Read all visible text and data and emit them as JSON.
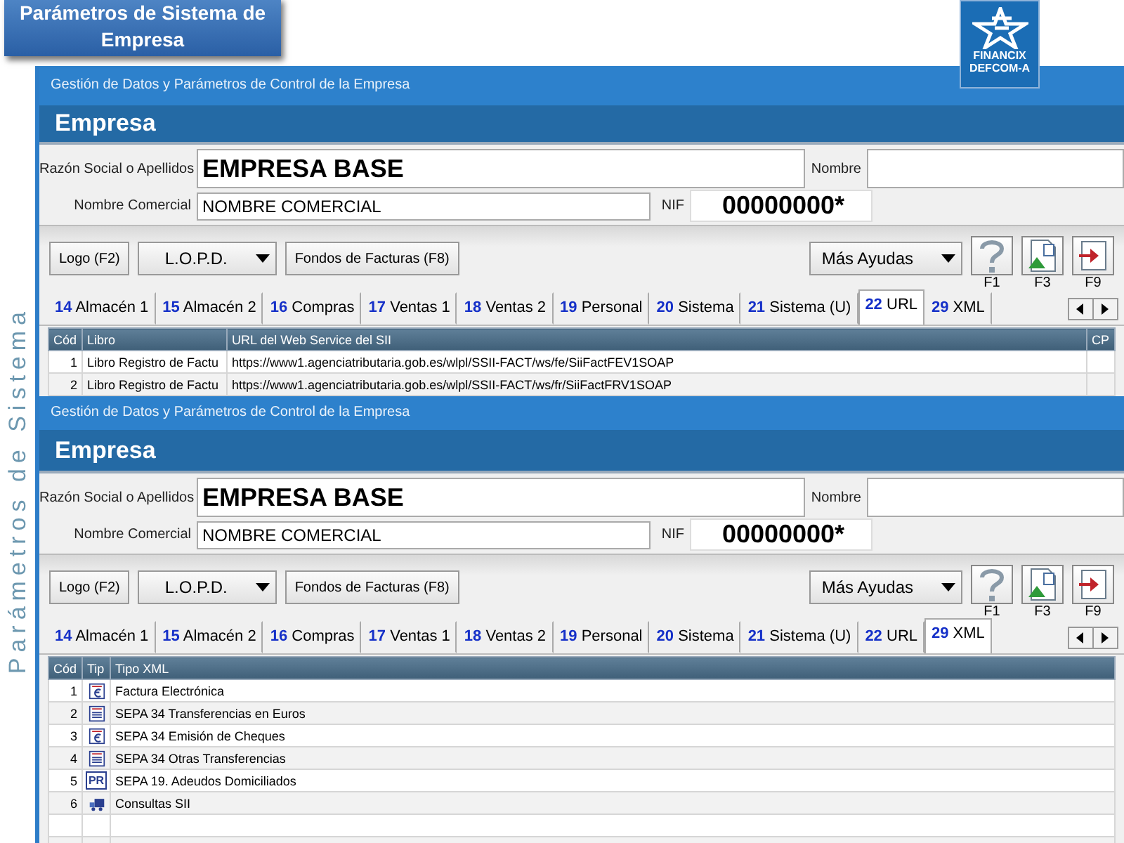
{
  "callout": {
    "title": "Parámetros de Sistema de Empresa"
  },
  "logo": {
    "line1": "FINANCIX",
    "line2": "DEFCOM-A"
  },
  "side_label": "Parámetros de Sistema",
  "panels": [
    {
      "header": "Gestión de Datos y Parámetros de Control de la Empresa",
      "title": "Empresa",
      "razon_label": "Razón Social o Apellidos",
      "razon": "EMPRESA BASE",
      "nombre_label": "Nombre",
      "nombre_comercial_label": "Nombre Comercial",
      "nombre_comercial": "NOMBRE COMERCIAL",
      "nif_label": "NIF",
      "nif": "00000000*",
      "buttons": [
        {
          "label": "Logo (F2)",
          "kind": "plain"
        },
        {
          "label": "L.O.P.D.",
          "kind": "dropdown"
        },
        {
          "label": "Fondos de Facturas (F8)",
          "kind": "plain"
        }
      ],
      "more_help": "Más Ayudas",
      "tools": [
        {
          "key": "F1",
          "kind": "help"
        },
        {
          "key": "F3",
          "kind": "image"
        },
        {
          "key": "F9",
          "kind": "exit"
        }
      ],
      "tabs": [
        {
          "num": "14",
          "label": "Almacén 1",
          "selected": false
        },
        {
          "num": "15",
          "label": "Almacén 2",
          "selected": false
        },
        {
          "num": "16",
          "label": "Compras",
          "selected": false
        },
        {
          "num": "17",
          "label": "Ventas 1",
          "selected": false
        },
        {
          "num": "18",
          "label": "Ventas 2",
          "selected": false
        },
        {
          "num": "19",
          "label": "Personal",
          "selected": false
        },
        {
          "num": "20",
          "label": "Sistema",
          "selected": false
        },
        {
          "num": "21",
          "label": "Sistema (U)",
          "selected": false
        },
        {
          "num": "22",
          "label": "URL",
          "selected": true
        },
        {
          "num": "29",
          "label": "XML",
          "selected": false
        }
      ],
      "table": {
        "kind": "url",
        "columns": [
          "Cód",
          "Libro",
          "URL del Web Service del SII",
          "CP"
        ],
        "rows": [
          {
            "cod": "1",
            "libro": "Libro Registro de Factu",
            "url": "https://www1.agenciatributaria.gob.es/wlpl/SSII-FACT/ws/fe/SiiFactFEV1SOAP"
          },
          {
            "cod": "2",
            "libro": "Libro Registro de Factu",
            "url": "https://www1.agenciatributaria.gob.es/wlpl/SSII-FACT/ws/fr/SiiFactFRV1SOAP"
          }
        ]
      }
    },
    {
      "header": "Gestión de Datos y Parámetros de Control de la Empresa",
      "title": "Empresa",
      "razon_label": "Razón Social o Apellidos",
      "razon": "EMPRESA BASE",
      "nombre_label": "Nombre",
      "nombre_comercial_label": "Nombre Comercial",
      "nombre_comercial": "NOMBRE COMERCIAL",
      "nif_label": "NIF",
      "nif": "00000000*",
      "buttons": [
        {
          "label": "Logo (F2)",
          "kind": "plain"
        },
        {
          "label": "L.O.P.D.",
          "kind": "dropdown"
        },
        {
          "label": "Fondos de Facturas (F8)",
          "kind": "plain"
        }
      ],
      "more_help": "Más Ayudas",
      "tools": [
        {
          "key": "F1",
          "kind": "help"
        },
        {
          "key": "F3",
          "kind": "image"
        },
        {
          "key": "F9",
          "kind": "exit"
        }
      ],
      "tabs": [
        {
          "num": "14",
          "label": "Almacén 1",
          "selected": false
        },
        {
          "num": "15",
          "label": "Almacén 2",
          "selected": false
        },
        {
          "num": "16",
          "label": "Compras",
          "selected": false
        },
        {
          "num": "17",
          "label": "Ventas 1",
          "selected": false
        },
        {
          "num": "18",
          "label": "Ventas 2",
          "selected": false
        },
        {
          "num": "19",
          "label": "Personal",
          "selected": false
        },
        {
          "num": "20",
          "label": "Sistema",
          "selected": false
        },
        {
          "num": "21",
          "label": "Sistema (U)",
          "selected": false
        },
        {
          "num": "22",
          "label": "URL",
          "selected": false
        },
        {
          "num": "29",
          "label": "XML",
          "selected": true
        }
      ],
      "table": {
        "kind": "xml",
        "columns": [
          "Cód",
          "Tip",
          "Tipo XML"
        ],
        "rows": [
          {
            "cod": "1",
            "kind": "euro",
            "tipo": "Factura Electrónica"
          },
          {
            "cod": "2",
            "kind": "list",
            "tipo": "SEPA 34 Transferencias en Euros"
          },
          {
            "cod": "3",
            "kind": "euro",
            "tipo": "SEPA 34 Emisión de Cheques"
          },
          {
            "cod": "4",
            "kind": "list",
            "tipo": "SEPA 34 Otras Transferencias"
          },
          {
            "cod": "5",
            "kind": "letters",
            "icon_text": "PR",
            "tipo": "SEPA 19. Adeudos Domiciliados"
          },
          {
            "cod": "6",
            "kind": "truck",
            "tipo": "Consultas SII"
          }
        ]
      }
    }
  ]
}
